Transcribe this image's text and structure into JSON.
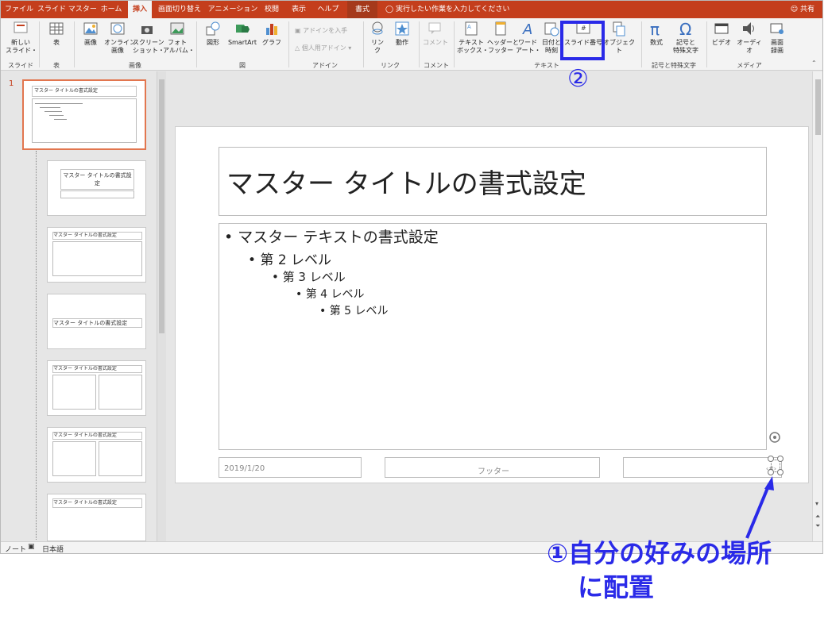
{
  "tabs": [
    {
      "label": "ファイル"
    },
    {
      "label": "スライド マスター"
    },
    {
      "label": "ホーム"
    },
    {
      "label": "挿入"
    },
    {
      "label": "画面切り替え"
    },
    {
      "label": "アニメーション"
    },
    {
      "label": "校閲"
    },
    {
      "label": "表示"
    },
    {
      "label": "ヘルプ"
    },
    {
      "label": "書式"
    }
  ],
  "tell_me": "実行したい作業を入力してください",
  "share": "共有",
  "ribbon": {
    "new_slide": "新しい\nスライド・",
    "group_slide": "スライド",
    "table": "表",
    "group_table": "表",
    "picture": "画像",
    "online_picture": "オンライン\n画像",
    "screenshot": "スクリーン\nショット・",
    "photo_album": "フォト\nアルバム・",
    "group_image": "画像",
    "shapes": "図形",
    "smartart": "SmartArt",
    "chart": "グラフ",
    "group_figure": "図",
    "get_addins": "アドインを入手",
    "my_addins": "個人用アドイン",
    "group_addin": "アドイン",
    "link": "リン\nク",
    "action": "動作",
    "group_link": "リンク",
    "comment": "コメント",
    "group_comment": "コメント",
    "textbox": "テキスト\nボックス・",
    "header_footer": "ヘッダーと\nフッター",
    "wordart": "ワード\nアート・",
    "datetime": "日付と\n時刻",
    "slide_number": "スライド番号",
    "object": "オブジェクト",
    "group_text": "テキスト",
    "equation": "数式",
    "symbol": "記号と\n特殊文字",
    "group_symbol": "記号と特殊文字",
    "video": "ビデオ",
    "audio": "オーディオ",
    "screen_record": "画面\n録画",
    "group_media": "メディア"
  },
  "thumbs": {
    "slide_index": "1",
    "master_title": "マスター タイトルの書式設定",
    "layout1_title": "マスター タイトルの書式設定",
    "layout_title": "マスター タイトルの書式設定"
  },
  "slide": {
    "title": "マスター タイトルの書式設定",
    "bullets": [
      "• マスター テキストの書式設定",
      "• 第 2 レベル",
      "• 第 3 レベル",
      "• 第 4 レベル",
      "• 第 5 レベル"
    ],
    "date": "2019/1/20",
    "footer": "フッター",
    "number": "‹#›"
  },
  "status": {
    "notes": "ノート",
    "language": "日本語"
  },
  "annotations": {
    "step2": "②",
    "step1_line1": "①自分の好みの場所",
    "step1_line2": "に配置"
  },
  "colors": {
    "accent": "#c43e1c",
    "annotation": "#2a2ae8"
  }
}
